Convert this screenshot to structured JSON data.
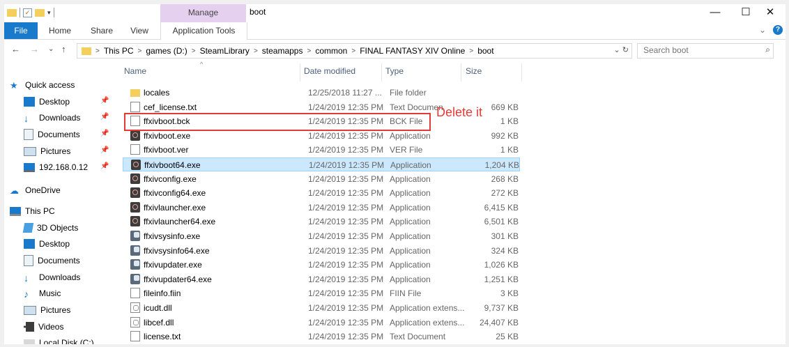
{
  "titlebar": {
    "manage_tab": "Manage",
    "window_title": "boot",
    "minimize": "—",
    "maximize": "☐",
    "close": "✕"
  },
  "ribbon": {
    "tabs": [
      "File",
      "Home",
      "Share",
      "View",
      "Application Tools"
    ],
    "expand": "⌄",
    "help": "?"
  },
  "navbar": {
    "back": "←",
    "forward": "→",
    "recent": "⌄",
    "up": "↑",
    "breadcrumbs": [
      "This PC",
      "games (D:)",
      "SteamLibrary",
      "steamapps",
      "common",
      "FINAL FANTASY XIV Online",
      "boot"
    ],
    "refresh": "⌄ ↻",
    "search_placeholder": "Search boot",
    "search_icon": "⌕"
  },
  "nav_pane": [
    {
      "label": "Quick access",
      "icon": "star-icon",
      "pinned": false
    },
    {
      "label": "Desktop",
      "icon": "desktop-icon",
      "pinned": true
    },
    {
      "label": "Downloads",
      "icon": "download-icon",
      "pinned": true
    },
    {
      "label": "Documents",
      "icon": "documents-icon",
      "pinned": true
    },
    {
      "label": "Pictures",
      "icon": "pictures-icon",
      "pinned": true
    },
    {
      "label": "192.168.0.12",
      "icon": "network-drive-icon",
      "pinned": true
    },
    {
      "label": "OneDrive",
      "icon": "cloud-icon",
      "pinned": false
    },
    {
      "label": "This PC",
      "icon": "computer-icon",
      "pinned": false
    },
    {
      "label": "3D Objects",
      "icon": "cube-icon",
      "pinned": false
    },
    {
      "label": "Desktop",
      "icon": "desktop-icon",
      "pinned": false
    },
    {
      "label": "Documents",
      "icon": "documents-icon",
      "pinned": false
    },
    {
      "label": "Downloads",
      "icon": "download-icon",
      "pinned": false
    },
    {
      "label": "Music",
      "icon": "music-icon",
      "pinned": false
    },
    {
      "label": "Pictures",
      "icon": "pictures-icon",
      "pinned": false
    },
    {
      "label": "Videos",
      "icon": "videos-icon",
      "pinned": false
    },
    {
      "label": "Local Disk (C:)",
      "icon": "disk-icon",
      "pinned": false
    }
  ],
  "pin_glyph": "📌",
  "columns": {
    "name": "Name",
    "date": "Date modified",
    "type": "Type",
    "size": "Size",
    "sort_glyph": "^"
  },
  "files": [
    {
      "name": "locales",
      "date": "12/25/2018 11:27 ...",
      "type": "File folder",
      "size": "",
      "icon": "folder-icon"
    },
    {
      "name": "cef_license.txt",
      "date": "1/24/2019 12:35 PM",
      "type": "Text Documen",
      "size": "669 KB",
      "icon": "text-file-icon"
    },
    {
      "name": "ffxivboot.bck",
      "date": "1/24/2019 12:35 PM",
      "type": "BCK File",
      "size": "1 KB",
      "icon": "file-icon"
    },
    {
      "name": "ffxivboot.exe",
      "date": "1/24/2019 12:35 PM",
      "type": "Application",
      "size": "992 KB",
      "icon": "app-icon"
    },
    {
      "name": "ffxivboot.ver",
      "date": "1/24/2019 12:35 PM",
      "type": "VER File",
      "size": "1 KB",
      "icon": "file-icon"
    },
    {
      "name": "ffxivboot64.exe",
      "date": "1/24/2019 12:35 PM",
      "type": "Application",
      "size": "1,204 KB",
      "icon": "app-icon"
    },
    {
      "name": "ffxivconfig.exe",
      "date": "1/24/2019 12:35 PM",
      "type": "Application",
      "size": "268 KB",
      "icon": "app-icon"
    },
    {
      "name": "ffxivconfig64.exe",
      "date": "1/24/2019 12:35 PM",
      "type": "Application",
      "size": "272 KB",
      "icon": "app-icon"
    },
    {
      "name": "ffxivlauncher.exe",
      "date": "1/24/2019 12:35 PM",
      "type": "Application",
      "size": "6,415 KB",
      "icon": "app-icon"
    },
    {
      "name": "ffxivlauncher64.exe",
      "date": "1/24/2019 12:35 PM",
      "type": "Application",
      "size": "6,501 KB",
      "icon": "app-icon"
    },
    {
      "name": "ffxivsysinfo.exe",
      "date": "1/24/2019 12:35 PM",
      "type": "Application",
      "size": "301 KB",
      "icon": "sysinfo-app-icon"
    },
    {
      "name": "ffxivsysinfo64.exe",
      "date": "1/24/2019 12:35 PM",
      "type": "Application",
      "size": "324 KB",
      "icon": "sysinfo-app-icon"
    },
    {
      "name": "ffxivupdater.exe",
      "date": "1/24/2019 12:35 PM",
      "type": "Application",
      "size": "1,026 KB",
      "icon": "sysinfo-app-icon"
    },
    {
      "name": "ffxivupdater64.exe",
      "date": "1/24/2019 12:35 PM",
      "type": "Application",
      "size": "1,251 KB",
      "icon": "sysinfo-app-icon"
    },
    {
      "name": "fileinfo.fiin",
      "date": "1/24/2019 12:35 PM",
      "type": "FIIN File",
      "size": "3 KB",
      "icon": "file-icon"
    },
    {
      "name": "icudt.dll",
      "date": "1/24/2019 12:35 PM",
      "type": "Application extens...",
      "size": "9,737 KB",
      "icon": "dll-icon"
    },
    {
      "name": "libcef.dll",
      "date": "1/24/2019 12:35 PM",
      "type": "Application extens...",
      "size": "24,407 KB",
      "icon": "dll-icon"
    },
    {
      "name": "license.txt",
      "date": "1/24/2019 12:35 PM",
      "type": "Text Document",
      "size": "25 KB",
      "icon": "text-file-icon"
    }
  ],
  "selected_file": "ffxivboot64.exe",
  "annotation": {
    "text": "Delete it",
    "color": "#e53935"
  }
}
